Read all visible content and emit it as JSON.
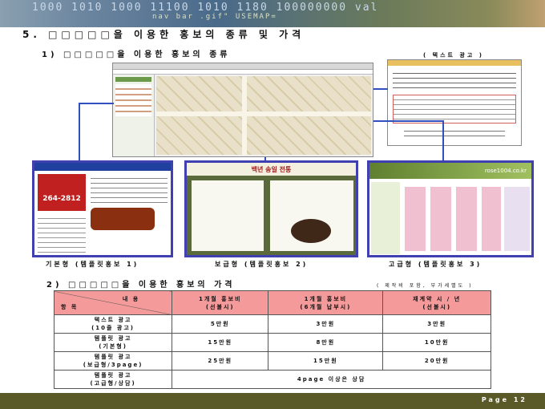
{
  "banner": {
    "code_line1": "1000 1010 1000 11100 1010 1180 100000000 val",
    "code_line2": "nav bar .gif\" USEMAP="
  },
  "title": "5. □□□□□을 이용한 홍보의 종류 및 가격",
  "section1": {
    "heading": "1) □□□□□을 이용한 홍보의 종류",
    "text_ad_label": "( 텍스트 광고 )",
    "templates": [
      {
        "label": "기본형 (템플릿홍보 1)",
        "phone": "264-2812"
      },
      {
        "label": "보급형 (템플릿홍보 2)",
        "banner": "백년 송일 전통"
      },
      {
        "label": "고급형 (템플릿홍보 3)",
        "brand": "rose1004.co.kr"
      }
    ]
  },
  "section2": {
    "heading": "2) □□□□□을 이용한 홍보의 가격",
    "note": "( 제작비 포함, 부가세별도 )",
    "header": {
      "corner_top": "내 용",
      "corner_bottom": "항 목",
      "cols": [
        [
          "1개월 홍보비",
          "(선불시)"
        ],
        [
          "1개월 홍보비",
          "(6개월 납부시)"
        ],
        [
          "재계약 시 / 년",
          "(선불시)"
        ]
      ]
    },
    "rows": [
      {
        "item": [
          "텍스트 광고",
          "(10줄 광고)"
        ],
        "values": [
          "5만원",
          "3만원",
          "3만원"
        ]
      },
      {
        "item": [
          "템플릿 광고",
          "(기본형)"
        ],
        "values": [
          "15만원",
          "8만원",
          "10만원"
        ]
      },
      {
        "item": [
          "템플릿 광고",
          "(보급형/3page)"
        ],
        "values": [
          "25만원",
          "15만원",
          "20만원"
        ]
      },
      {
        "item": [
          "템플릿 광고",
          "(고급형/상담)"
        ],
        "merged": "4page 이상은 상담"
      }
    ]
  },
  "footer": {
    "page": "Page 12"
  }
}
